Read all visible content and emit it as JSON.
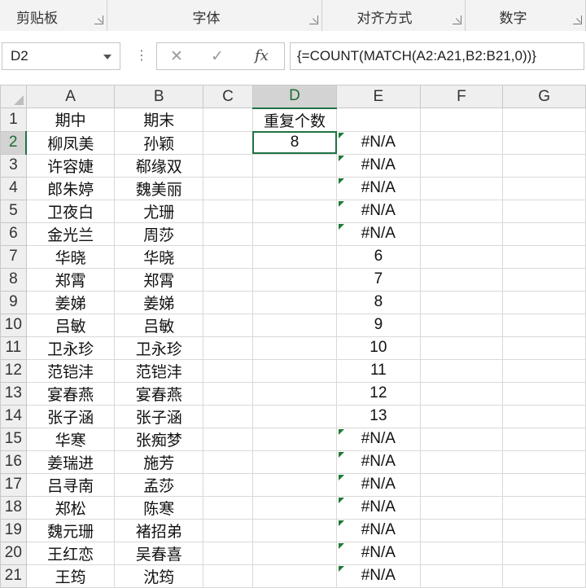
{
  "ribbon": {
    "groups": [
      {
        "label": "剪贴板"
      },
      {
        "label": "字体"
      },
      {
        "label": "对齐方式"
      },
      {
        "label": "数字"
      }
    ]
  },
  "formula_bar": {
    "name_box": "D2",
    "more_glyph": "⋮",
    "cancel_glyph": "✕",
    "enter_glyph": "✓",
    "fx_label": "fx",
    "formula": "{=COUNT(MATCH(A2:A21,B2:B21,0))}"
  },
  "sheet": {
    "columns": [
      "A",
      "B",
      "C",
      "D",
      "E",
      "F",
      "G"
    ],
    "rows": [
      {
        "num": "1",
        "A": "期中",
        "B": "期末",
        "D": "重复个数",
        "E": ""
      },
      {
        "num": "2",
        "A": "柳凤美",
        "B": "孙颖",
        "D": "8",
        "E": "#N/A"
      },
      {
        "num": "3",
        "A": "许容婕",
        "B": "郗缘双",
        "D": "",
        "E": "#N/A"
      },
      {
        "num": "4",
        "A": "郎朱婷",
        "B": "魏美丽",
        "D": "",
        "E": "#N/A"
      },
      {
        "num": "5",
        "A": "卫夜白",
        "B": "尤珊",
        "D": "",
        "E": "#N/A"
      },
      {
        "num": "6",
        "A": "金光兰",
        "B": "周莎",
        "D": "",
        "E": "#N/A"
      },
      {
        "num": "7",
        "A": "华晓",
        "B": "华晓",
        "D": "",
        "E": "6"
      },
      {
        "num": "8",
        "A": "郑霄",
        "B": "郑霄",
        "D": "",
        "E": "7"
      },
      {
        "num": "9",
        "A": "姜娣",
        "B": "姜娣",
        "D": "",
        "E": "8"
      },
      {
        "num": "10",
        "A": "吕敏",
        "B": "吕敏",
        "D": "",
        "E": "9"
      },
      {
        "num": "11",
        "A": "卫永珍",
        "B": "卫永珍",
        "D": "",
        "E": "10"
      },
      {
        "num": "12",
        "A": "范铠沣",
        "B": "范铠沣",
        "D": "",
        "E": "11"
      },
      {
        "num": "13",
        "A": "宴春燕",
        "B": "宴春燕",
        "D": "",
        "E": "12"
      },
      {
        "num": "14",
        "A": "张子涵",
        "B": "张子涵",
        "D": "",
        "E": "13"
      },
      {
        "num": "15",
        "A": "华寒",
        "B": "张痴梦",
        "D": "",
        "E": "#N/A"
      },
      {
        "num": "16",
        "A": "姜瑞进",
        "B": "施芳",
        "D": "",
        "E": "#N/A"
      },
      {
        "num": "17",
        "A": "吕寻南",
        "B": "孟莎",
        "D": "",
        "E": "#N/A"
      },
      {
        "num": "18",
        "A": "郑松",
        "B": "陈寒",
        "D": "",
        "E": "#N/A"
      },
      {
        "num": "19",
        "A": "魏元珊",
        "B": "褚招弟",
        "D": "",
        "E": "#N/A"
      },
      {
        "num": "20",
        "A": "王红恋",
        "B": "吴春喜",
        "D": "",
        "E": "#N/A"
      },
      {
        "num": "21",
        "A": "王筠",
        "B": "沈筠",
        "D": "",
        "E": "#N/A"
      }
    ],
    "active_cell": "D2",
    "error_marker_color": "#1f7a34",
    "selection_color": "#217346"
  }
}
